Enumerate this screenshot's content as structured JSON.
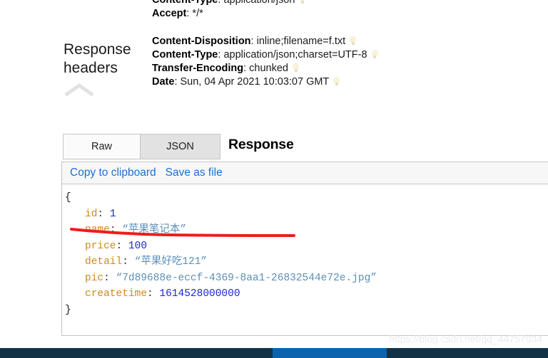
{
  "request_headers": {
    "lines": [
      {
        "name": "Content-Type",
        "sep": ": ",
        "value": "application/json",
        "bulb": true
      },
      {
        "name": "Accept",
        "sep": ": ",
        "value": "*/*",
        "bulb": false
      }
    ]
  },
  "response_headers": {
    "label_line1": "Response",
    "label_line2": "headers",
    "collapse_icon": "chevron-up-icon",
    "lines": [
      {
        "name": "Content-Disposition",
        "sep": ": ",
        "value": "inline;filename=f.txt",
        "bulb": true
      },
      {
        "name": "Content-Type",
        "sep": ": ",
        "value": "application/json;charset=UTF-8",
        "bulb": true
      },
      {
        "name": "Transfer-Encoding",
        "sep": ": ",
        "value": "chunked",
        "bulb": true
      },
      {
        "name": "Date",
        "sep": ": ",
        "value": "Sun, 04 Apr 2021 10:03:07 GMT",
        "bulb": true
      }
    ]
  },
  "tabs": {
    "raw_label": "Raw",
    "json_label": "JSON",
    "active": "JSON"
  },
  "section_title": "Response",
  "json_viewer": {
    "copy_label": "Copy to clipboard",
    "save_label": "Save as file",
    "open_brace": "{",
    "close_brace": "}",
    "entries": [
      {
        "key": "id",
        "value": "1",
        "type": "number"
      },
      {
        "key": "name",
        "value": "“苹果笔记本”",
        "type": "string"
      },
      {
        "key": "price",
        "value": "100",
        "type": "number"
      },
      {
        "key": "detail",
        "value": "“苹果好吃121”",
        "type": "string"
      },
      {
        "key": "pic",
        "value": "“7d89688e-eccf-4369-8aa1-26832544e72e.jpg”",
        "type": "string"
      },
      {
        "key": "createtime",
        "value": "1614528000000",
        "type": "number"
      }
    ]
  },
  "annotation": {
    "type": "red-underline",
    "color": "#ee1c1c"
  },
  "watermark": "https://blog.csdn.net/qq_44757034",
  "taskbar": {
    "background_color": "#143246",
    "active_item_color": "#0b64ad"
  }
}
